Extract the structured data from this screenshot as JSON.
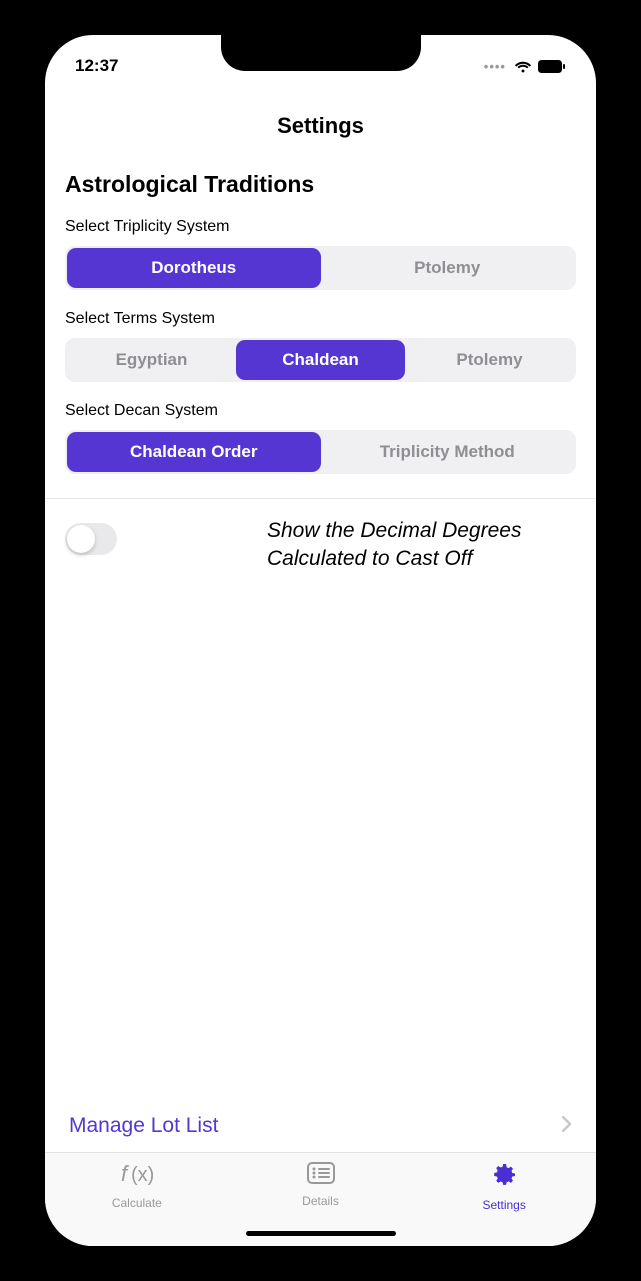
{
  "status": {
    "time": "12:37"
  },
  "header": {
    "title": "Settings"
  },
  "sections": {
    "title": "Astrological Traditions",
    "triplicity": {
      "label": "Select Triplicity System",
      "options": [
        "Dorotheus",
        "Ptolemy"
      ],
      "selected": 0
    },
    "terms": {
      "label": "Select Terms System",
      "options": [
        "Egyptian",
        "Chaldean",
        "Ptolemy"
      ],
      "selected": 1
    },
    "decan": {
      "label": "Select Decan System",
      "options": [
        "Chaldean Order",
        "Triplicity Method"
      ],
      "selected": 0
    }
  },
  "toggle": {
    "label": "Show the Decimal Degrees Calculated to Cast Off",
    "value": false
  },
  "manage": {
    "label": "Manage Lot List"
  },
  "tabs": {
    "items": [
      {
        "label": "Calculate"
      },
      {
        "label": "Details"
      },
      {
        "label": "Settings"
      }
    ],
    "active": 2
  },
  "colors": {
    "accent": "#5636d3"
  }
}
